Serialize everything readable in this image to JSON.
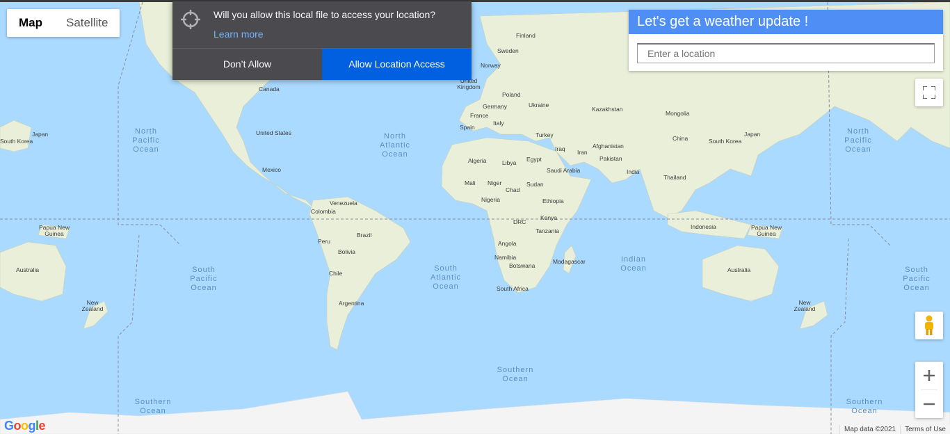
{
  "map_type": {
    "map_label": "Map",
    "satellite_label": "Satellite"
  },
  "permission_prompt": {
    "question": "Will you allow this local file to access your location?",
    "learn_more": "Learn more",
    "deny_label": "Don’t Allow",
    "allow_label": "Allow Location Access"
  },
  "weather_panel": {
    "title": "Let's get a weather update !",
    "placeholder": "Enter a location"
  },
  "countries": [
    {
      "name": "Finland"
    },
    {
      "name": "Sweden"
    },
    {
      "name": "Norway"
    },
    {
      "name": "United Kingdom"
    },
    {
      "name": "Poland"
    },
    {
      "name": "Germany"
    },
    {
      "name": "Ukraine"
    },
    {
      "name": "France"
    },
    {
      "name": "Italy"
    },
    {
      "name": "Spain"
    },
    {
      "name": "Turkey"
    },
    {
      "name": "Kazakhstan"
    },
    {
      "name": "Mongolia"
    },
    {
      "name": "China"
    },
    {
      "name": "Japan"
    },
    {
      "name": "South Korea"
    },
    {
      "name": "Afghanistan"
    },
    {
      "name": "Iraq"
    },
    {
      "name": "Iran"
    },
    {
      "name": "Pakistan"
    },
    {
      "name": "India"
    },
    {
      "name": "Thailand"
    },
    {
      "name": "Algeria"
    },
    {
      "name": "Libya"
    },
    {
      "name": "Egypt"
    },
    {
      "name": "Saudi Arabia"
    },
    {
      "name": "Mali"
    },
    {
      "name": "Niger"
    },
    {
      "name": "Chad"
    },
    {
      "name": "Sudan"
    },
    {
      "name": "Nigeria"
    },
    {
      "name": "Ethiopia"
    },
    {
      "name": "DRC"
    },
    {
      "name": "Kenya"
    },
    {
      "name": "Tanzania"
    },
    {
      "name": "Angola"
    },
    {
      "name": "Namibia"
    },
    {
      "name": "Botswana"
    },
    {
      "name": "Madagascar"
    },
    {
      "name": "South Africa"
    },
    {
      "name": "Canada"
    },
    {
      "name": "United States"
    },
    {
      "name": "Mexico"
    },
    {
      "name": "Venezuela"
    },
    {
      "name": "Colombia"
    },
    {
      "name": "Peru"
    },
    {
      "name": "Brazil"
    },
    {
      "name": "Bolivia"
    },
    {
      "name": "Chile"
    },
    {
      "name": "Argentina"
    },
    {
      "name": "Indonesia"
    },
    {
      "name": "Papua New Guinea"
    },
    {
      "name": "Australia"
    },
    {
      "name": "New Zealand"
    },
    {
      "name": "Japan"
    },
    {
      "name": "South Korea"
    },
    {
      "name": "Papua New Guinea"
    },
    {
      "name": "Australia"
    },
    {
      "name": "New Zealand"
    }
  ],
  "oceans": [
    {
      "name": "North Pacific Ocean"
    },
    {
      "name": "North Atlantic Ocean"
    },
    {
      "name": "South Pacific Ocean"
    },
    {
      "name": "South Atlantic Ocean"
    },
    {
      "name": "Indian Ocean"
    },
    {
      "name": "Southern Ocean"
    },
    {
      "name": "Southern Ocean"
    },
    {
      "name": "North Pacific Ocean"
    },
    {
      "name": "South Pacific Ocean"
    },
    {
      "name": "Southern Ocean"
    }
  ],
  "footer": {
    "map_data": "Map data ©2021",
    "terms": "Terms of Use"
  },
  "logo_text": "Google",
  "colors": {
    "water": "#aadaff",
    "land": "#e8f0d6",
    "prompt_bg": "#4a4a4f",
    "allow_bg": "#0060df",
    "weather_header": "#4f8ef5"
  }
}
